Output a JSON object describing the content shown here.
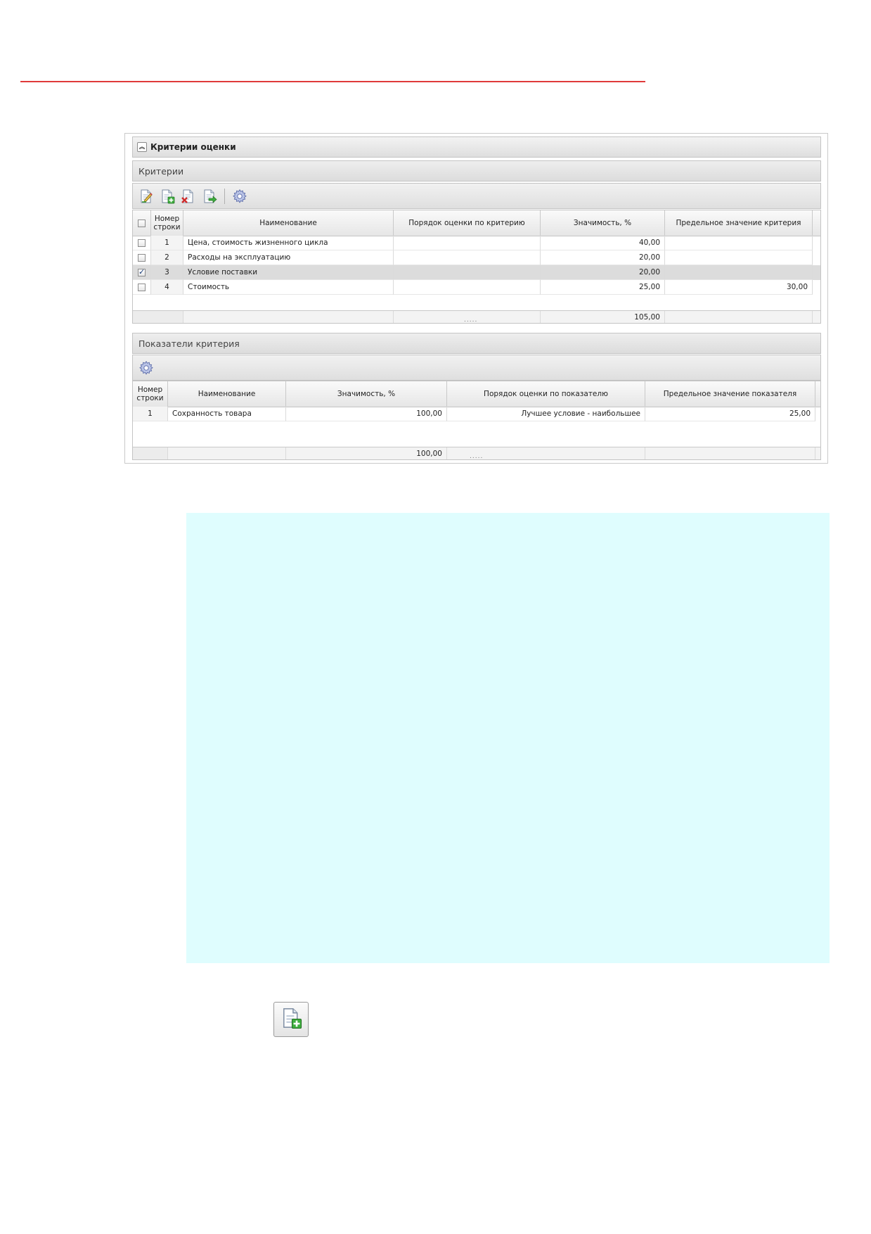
{
  "panel": {
    "title": "Критерии оценки",
    "criteria": {
      "section_title": "Критерии",
      "toolbar": [
        "edit-icon",
        "add-icon",
        "delete-icon",
        "export-icon",
        "settings-icon"
      ],
      "columns": [
        "Номер строки",
        "Наименование",
        "Порядок оценки по критерию",
        "Значимость, %",
        "Предельное значение критерия"
      ],
      "rows": [
        {
          "num": "1",
          "name": "Цена, стоимость жизненного цикла",
          "order": "",
          "weight": "40,00",
          "limit": "",
          "checked": false
        },
        {
          "num": "2",
          "name": "Расходы на эксплуатацию",
          "order": "",
          "weight": "20,00",
          "limit": "",
          "checked": false
        },
        {
          "num": "3",
          "name": "Условие поставки",
          "order": "",
          "weight": "20,00",
          "limit": "",
          "checked": true
        },
        {
          "num": "4",
          "name": "Стоимость",
          "order": "",
          "weight": "25,00",
          "limit": "30,00",
          "checked": false
        }
      ],
      "total_weight": "105,00",
      "resize_grip": "....."
    },
    "indicators": {
      "section_title": "Показатели критерия",
      "toolbar": [
        "settings-icon"
      ],
      "columns": [
        "Номер строки",
        "Наименование",
        "Значимость, %",
        "Порядок оценки по показателю",
        "Предельное значение показателя"
      ],
      "rows": [
        {
          "num": "1",
          "name": "Сохранность товара",
          "weight": "100,00",
          "order": "Лучшее условие - наибольшее",
          "limit": "25,00"
        }
      ],
      "total_weight": "100,00",
      "resize_grip": "....."
    }
  },
  "add_button": {
    "icon": "add-document-icon"
  },
  "colors": {
    "rule": "#e03a3a",
    "note_background": "#dffdfe",
    "selected_row": "#dcdcdc"
  }
}
